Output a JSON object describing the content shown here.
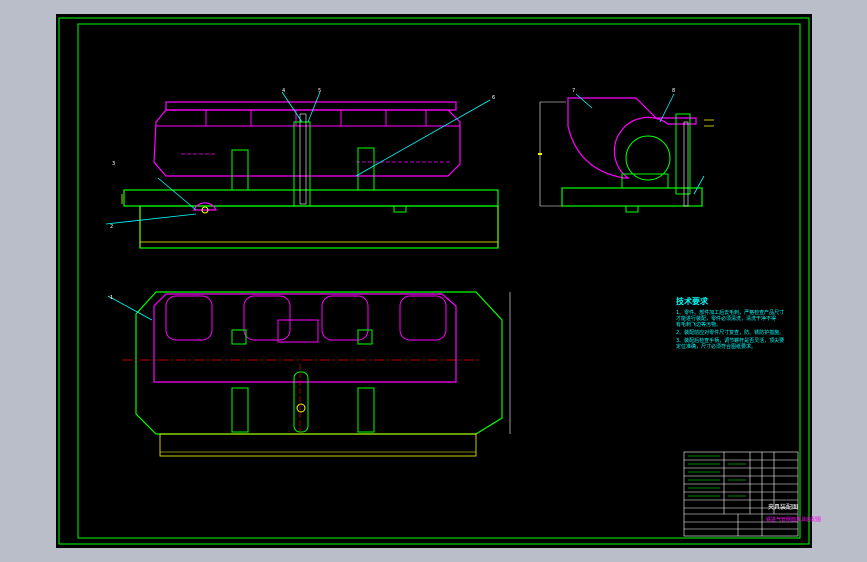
{
  "technical_requirements": {
    "title": "技术要求",
    "lines": [
      "1、零件、部件加工后去毛刺，严格检查产品尺寸",
      "   才能进行装配，零件必须清洗，清洗干净不得",
      "   有毛刺飞边等污物。",
      "2、装配前应对零件尺寸复查，防、锈防护措施。",
      "3、装配后检查手柄，调节螺杆是否灵活，顶尖要",
      "   定位准确，尺寸必须符合图纸要求。"
    ]
  },
  "title_block": {
    "title": "夹具装配图",
    "subtitle": "铣进气管侧面夹具装配图"
  },
  "part_balloons": [
    "1",
    "2",
    "3",
    "4",
    "5",
    "6",
    "7",
    "8"
  ],
  "colors": {
    "background": "#000000",
    "frame": "#00ff00",
    "part_outline": "#ff00ff",
    "fixture": "#00ff00",
    "dimension": "#ffff00",
    "leader": "#00ffff",
    "centerline": "#ff0000"
  }
}
